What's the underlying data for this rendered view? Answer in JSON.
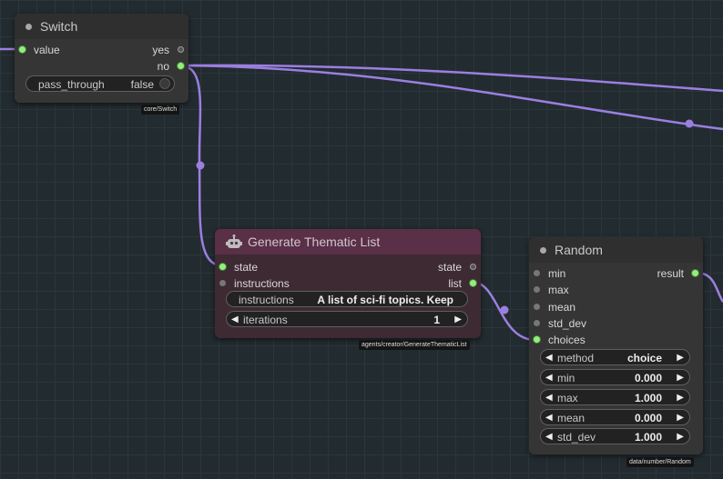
{
  "switch_node": {
    "title": "Switch",
    "inputs": [
      {
        "label": "value"
      }
    ],
    "outputs": [
      {
        "label": "yes"
      },
      {
        "label": "no"
      }
    ],
    "widgets": [
      {
        "label": "pass_through",
        "value": "false"
      }
    ],
    "tag": "core/Switch"
  },
  "thematic_node": {
    "title": "Generate Thematic List",
    "icon": "robot-icon",
    "inputs": [
      {
        "label": "state"
      },
      {
        "label": "instructions"
      }
    ],
    "outputs": [
      {
        "label": "state"
      },
      {
        "label": "list"
      }
    ],
    "widgets": [
      {
        "label": "instructions",
        "value": "A list of sci-fi topics. Keep"
      },
      {
        "label": "iterations",
        "value": "1"
      }
    ],
    "tag": "agents/creator/GenerateThematicList"
  },
  "random_node": {
    "title": "Random",
    "inputs": [
      {
        "label": "min"
      },
      {
        "label": "max"
      },
      {
        "label": "mean"
      },
      {
        "label": "std_dev"
      },
      {
        "label": "choices"
      }
    ],
    "outputs": [
      {
        "label": "result"
      }
    ],
    "widgets": [
      {
        "label": "method",
        "value": "choice"
      },
      {
        "label": "min",
        "value": "0.000"
      },
      {
        "label": "max",
        "value": "1.000"
      },
      {
        "label": "mean",
        "value": "0.000"
      },
      {
        "label": "std_dev",
        "value": "1.000"
      }
    ],
    "tag": "data/number/Random"
  },
  "colors": {
    "wire": "#9b7fe0",
    "title_thematic": "#5a2f48",
    "body_thematic": "#3e2a33",
    "slot_connected": "#8ff07a"
  }
}
